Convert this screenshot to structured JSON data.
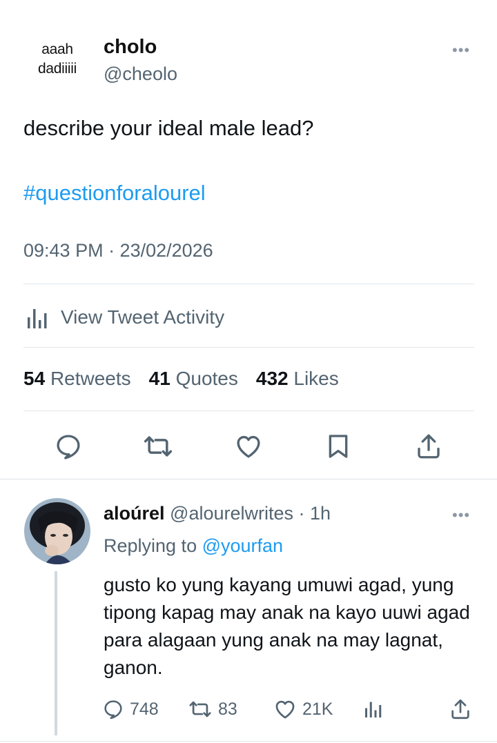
{
  "tweet": {
    "avatar_text": "aaah\ndadiiiii",
    "display_name": "cholo",
    "handle": "@cheolo",
    "text": "describe your ideal male lead?",
    "hashtag": "#questionforalourel",
    "timestamp": "09:43 PM · 23/02/2026",
    "activity_label": "View Tweet Activity",
    "stats": {
      "retweets_count": "54",
      "retweets_label": "Retweets",
      "quotes_count": "41",
      "quotes_label": "Quotes",
      "likes_count": "432",
      "likes_label": "Likes"
    },
    "actions": [
      "reply-icon",
      "retweet-icon",
      "like-icon",
      "bookmark-icon",
      "share-icon"
    ]
  },
  "reply": {
    "display_name": "aloúrel",
    "handle": "@alourelwrites",
    "time": "· 1h",
    "replying_prefix": "Replying to",
    "replying_to": "@yourfan",
    "text": "gusto ko yung kayang umuwi agad, yung tipong kapag may anak na kayo uuwi agad para alagaan yung anak na may lagnat, ganon.",
    "counts": {
      "replies": "748",
      "retweets": "83",
      "likes": "21K"
    }
  },
  "colors": {
    "accent": "#1d9bf0",
    "secondary_text": "#536471",
    "primary_text": "#0f1419",
    "divider": "#e1e6ea"
  }
}
